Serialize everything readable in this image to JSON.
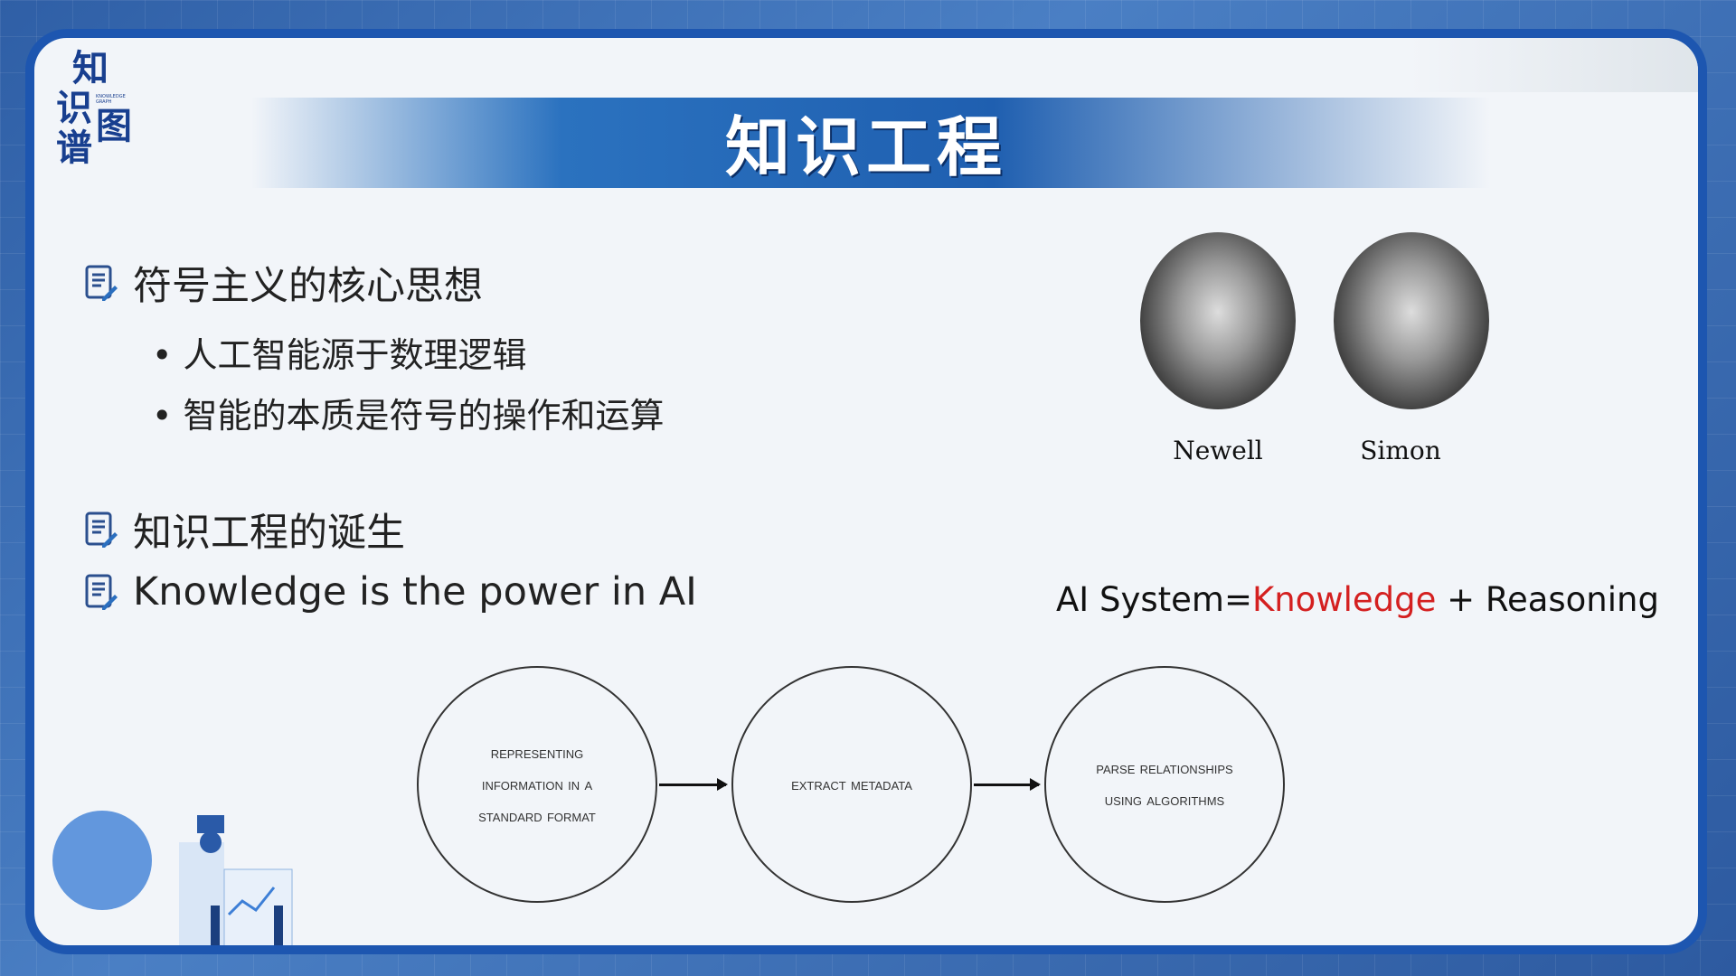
{
  "logo": {
    "chars": [
      "知",
      "识",
      "图",
      "谱"
    ],
    "subtitle": "KNOWLEDGE GRAPH"
  },
  "title": "知识工程",
  "sections": [
    {
      "heading": "符号主义的核心思想",
      "bullets": [
        "人工智能源于数理逻辑",
        "智能的本质是符号的操作和运算"
      ]
    },
    {
      "heading": "知识工程的诞生"
    },
    {
      "heading": "Knowledge is the power in AI"
    }
  ],
  "people": [
    {
      "name": "Newell"
    },
    {
      "name": "Simon"
    }
  ],
  "equation": {
    "prefix": "AI System=",
    "highlight": "Knowledge",
    "suffix": " + Reasoning",
    "highlight_color": "#d42020"
  },
  "flow": [
    "Representing information in a standard format",
    "Extract metadata",
    "Parse relationships using algorithms"
  ]
}
